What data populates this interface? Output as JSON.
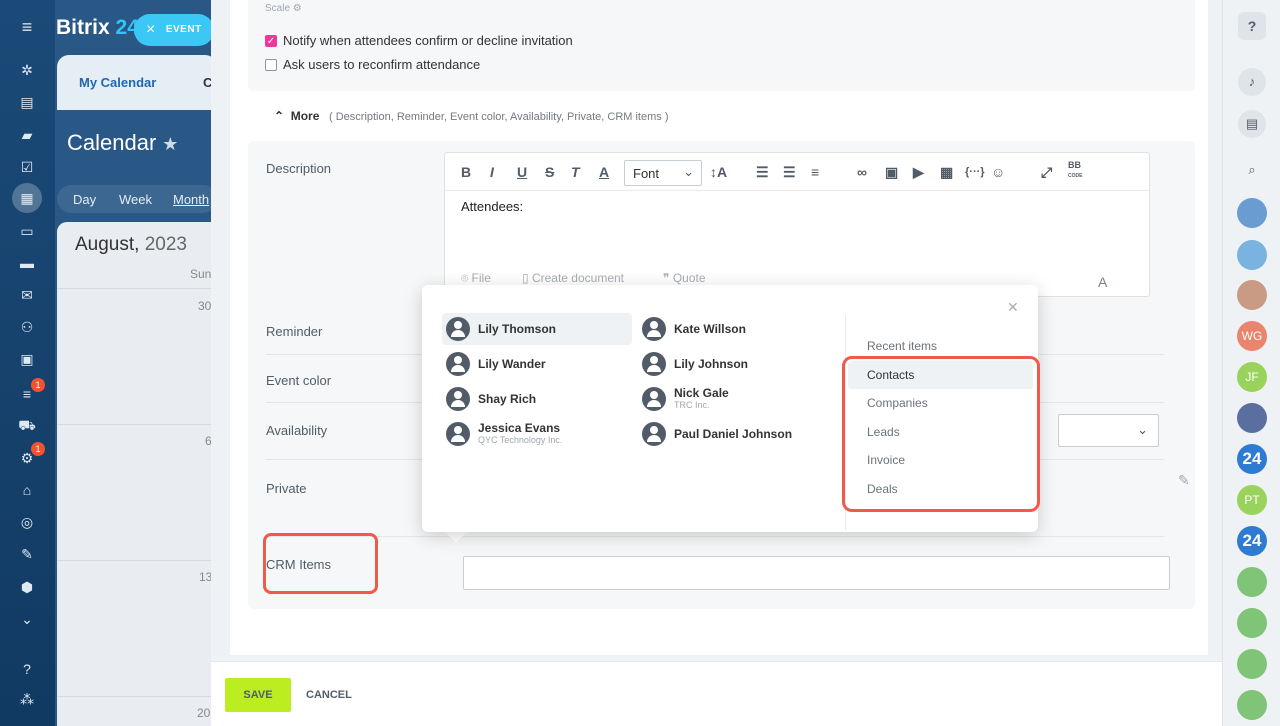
{
  "app": {
    "logo_text": "Bitrix",
    "logo_num": "24",
    "event_label": "EVENT"
  },
  "left_nav": {
    "badges": [
      "1",
      "1"
    ],
    "icons": [
      "activity-icon",
      "feed-icon",
      "chat-icon",
      "tasks-icon",
      "calendar-icon",
      "docs-icon",
      "drive-icon",
      "mail-icon",
      "groups-icon",
      "contacts-icon",
      "crm-icon",
      "shop-icon",
      "automation-icon",
      "company-icon",
      "marketing-icon",
      "sign-icon",
      "inventory-icon",
      "more-icon",
      "help-icon",
      "sitemap-icon"
    ]
  },
  "calendar": {
    "tab_active": "My Calendar",
    "tab_next": "C",
    "title": "Calendar",
    "views": [
      "Day",
      "Week",
      "Month"
    ],
    "month": "August,",
    "year": "2023",
    "weekday": "Sun",
    "days": [
      "30",
      "6",
      "13",
      "20"
    ]
  },
  "form": {
    "scale_label": "Scale",
    "notify_label": "Notify when attendees confirm or decline invitation",
    "notify_checked": true,
    "reconfirm_label": "Ask users to reconfirm attendance",
    "reconfirm_checked": false,
    "more_label": "More",
    "more_items": "( Description,  Reminder,  Event color,  Availability,  Private,  CRM items )",
    "fields": {
      "description": "Description",
      "reminder": "Reminder",
      "event_color": "Event color",
      "availability": "Availability",
      "private": "Private",
      "crm_items": "CRM Items"
    },
    "editor": {
      "font_label": "Font",
      "content": "Attendees:",
      "footer_file": "File",
      "footer_create_doc": "Create document",
      "footer_quote": "Quote",
      "bb_label": "BB",
      "bb_sub": "CODE"
    }
  },
  "crm_popup": {
    "people": [
      {
        "name": "Lily Thomson",
        "sub": ""
      },
      {
        "name": "Kate Willson",
        "sub": ""
      },
      {
        "name": "Lily Wander",
        "sub": ""
      },
      {
        "name": "Lily Johnson",
        "sub": ""
      },
      {
        "name": "Shay Rich",
        "sub": ""
      },
      {
        "name": "Nick Gale",
        "sub": "TRC Inc."
      },
      {
        "name": "Jessica Evans",
        "sub": "QYC Technology Inc."
      },
      {
        "name": "Paul Daniel Johnson",
        "sub": ""
      }
    ],
    "categories": [
      "Recent items",
      "Contacts",
      "Companies",
      "Leads",
      "Invoice",
      "Deals"
    ],
    "selected_category": "Contacts"
  },
  "footer": {
    "save_label": "SAVE",
    "cancel_label": "CANCEL"
  },
  "right_bar": {
    "help": "?",
    "avatars": [
      {
        "text": "",
        "color": "#6a9bd1"
      },
      {
        "text": "",
        "color": "#7ab3e0"
      },
      {
        "text": "",
        "color": "#c99a84"
      },
      {
        "text": "WG",
        "color": "#e9856d"
      },
      {
        "text": "JF",
        "color": "#9ad35b"
      },
      {
        "text": "",
        "color": "#5b6ea0"
      },
      {
        "text": "24",
        "color": "#2e7bd1"
      },
      {
        "text": "PT",
        "color": "#9ad35b"
      },
      {
        "text": "24",
        "color": "#2e7bd1"
      },
      {
        "text": "",
        "color": "#80c477"
      },
      {
        "text": "",
        "color": "#80c477"
      },
      {
        "text": "",
        "color": "#80c477"
      },
      {
        "text": "",
        "color": "#80c477"
      }
    ]
  },
  "colors": {
    "accent": "#2fc6f6",
    "save": "#bbed21",
    "highlight": "#f05a4a",
    "checkbox": "#f0369a"
  }
}
